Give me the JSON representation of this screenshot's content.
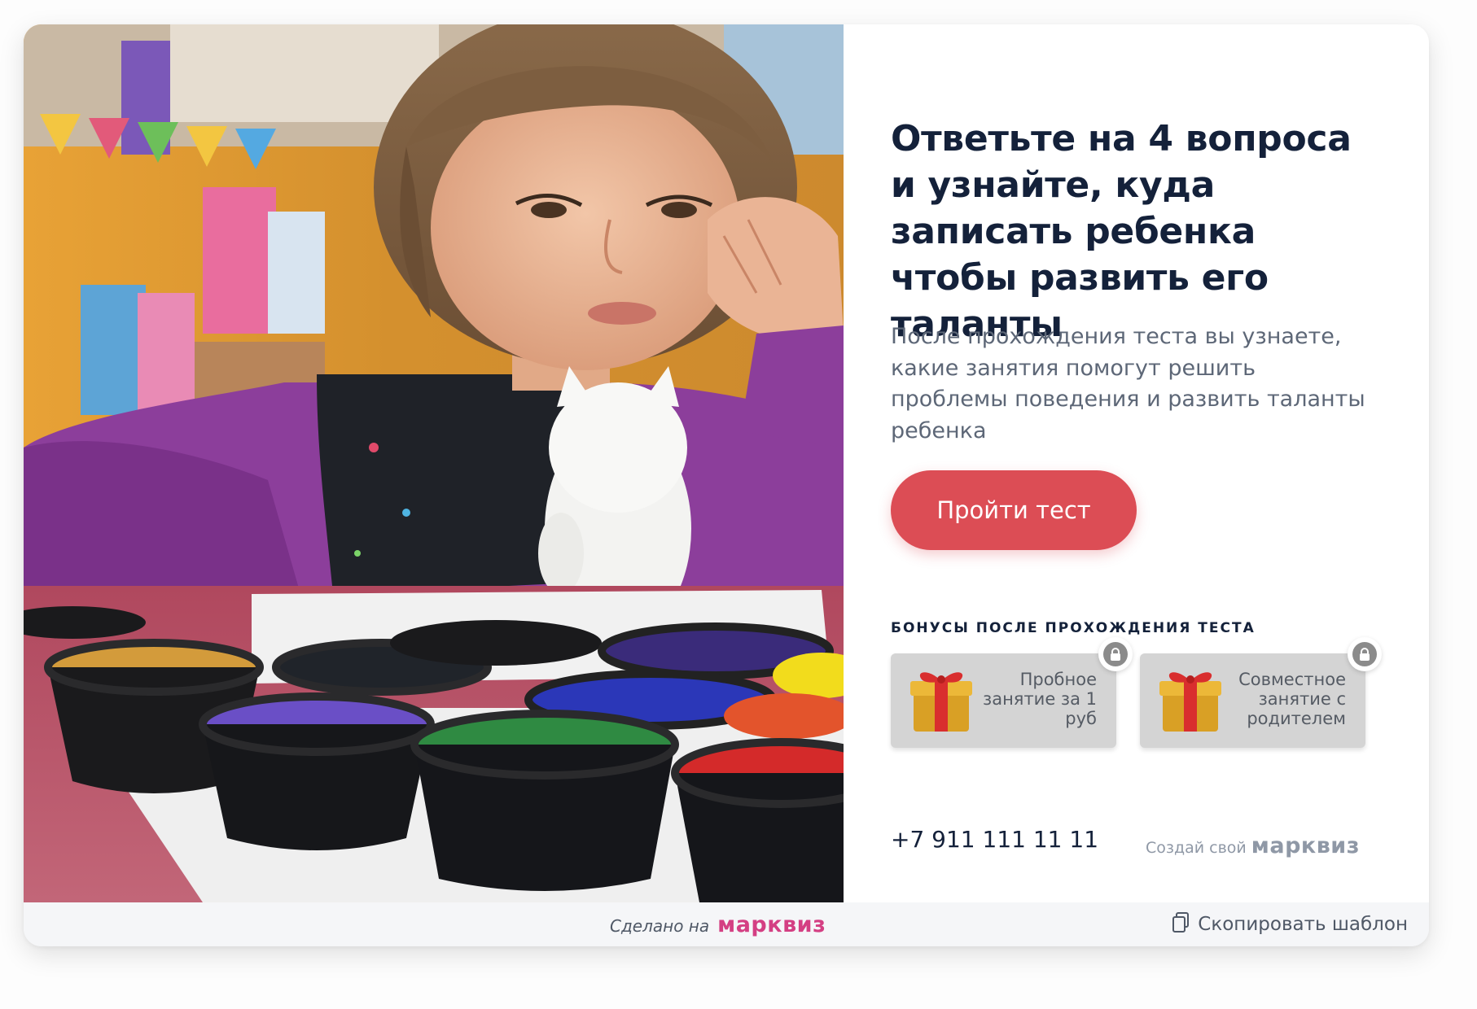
{
  "quiz": {
    "title": "Ответьте на 4 вопроса и узнайте, куда записать ребенка чтобы развить его таланты",
    "subtitle": "После прохождения теста вы узнаете, какие занятия помогут решить проблемы поведения и развить таланты ребенка",
    "cta_label": "Пройти тест",
    "bonuses_heading": "БОНУСЫ ПОСЛЕ ПРОХОЖДЕНИЯ ТЕСТА",
    "bonuses": [
      {
        "label": "Пробное занятие за 1 руб",
        "icon": "gift-icon",
        "locked": true
      },
      {
        "label": "Совместное занятие с родителем",
        "icon": "gift-icon",
        "locked": true
      }
    ],
    "phone": "+7 911 111 11 11",
    "create_own_label": "Создай свой",
    "create_own_brand": "марквиз"
  },
  "footer": {
    "made_on_label": "Сделано на",
    "made_on_brand": "марквиз",
    "copy_template_label": "Скопировать шаблон"
  },
  "colors": {
    "accent": "#dc4d55",
    "title": "#14213a",
    "brand_pink": "#d43f83",
    "muted": "#8f98a6"
  }
}
